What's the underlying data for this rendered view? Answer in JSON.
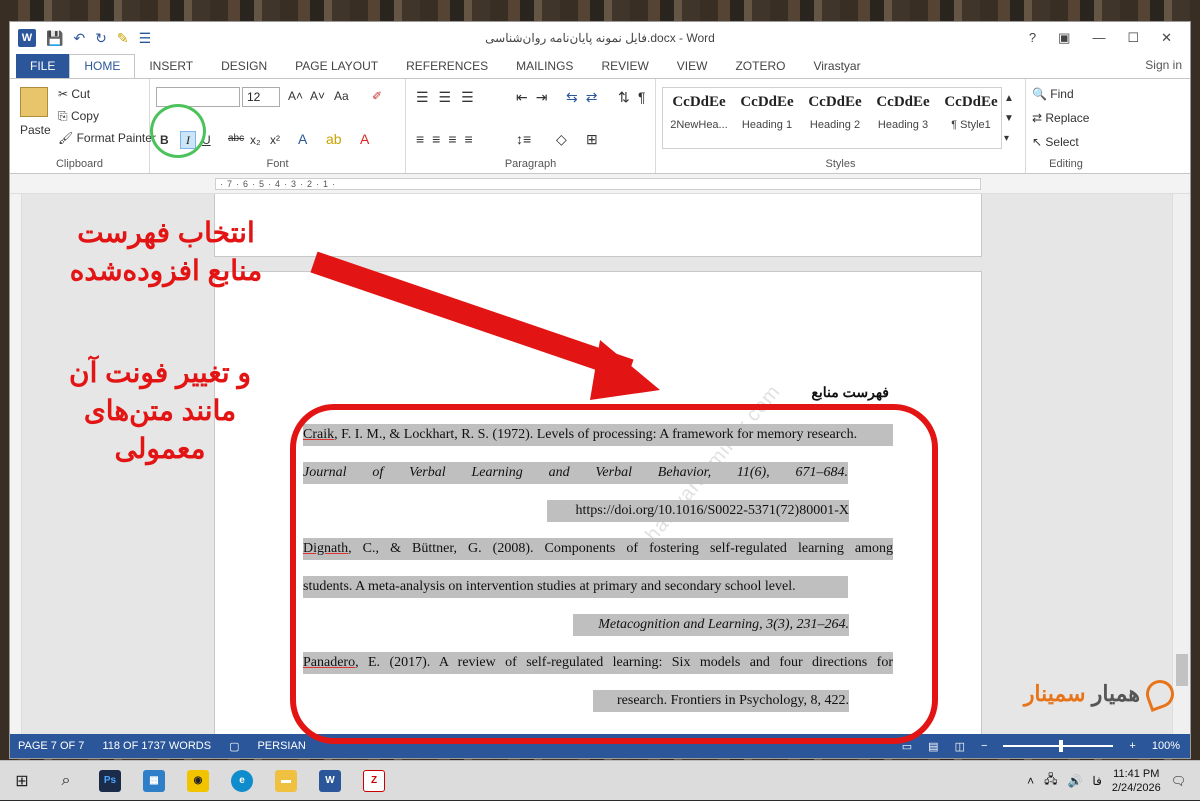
{
  "window": {
    "title": "فایل نمونه پایان‌نامه روان‌شناسی.docx - Word",
    "help": "?",
    "controls": [
      "—",
      "☐",
      "✕"
    ]
  },
  "qat": {
    "save_icon": "save-icon",
    "undo_icon": "undo-icon",
    "redo_icon": "redo-icon"
  },
  "tabs": {
    "file": "FILE",
    "home": "HOME",
    "insert": "INSERT",
    "design": "DESIGN",
    "page_layout": "PAGE LAYOUT",
    "references": "REFERENCES",
    "mailings": "MAILINGS",
    "review": "REVIEW",
    "view": "VIEW",
    "zotero": "ZOTERO",
    "virastyar": "Virastyar",
    "signin": "Sign in"
  },
  "clipboard": {
    "paste": "Paste",
    "cut": "Cut",
    "copy": "Copy",
    "format_painter": "Format Painter",
    "label": "Clipboard"
  },
  "font": {
    "name": "",
    "size": "12",
    "bold": "B",
    "italic": "I",
    "underline": "U",
    "strike": "abc",
    "sub": "x₂",
    "sup": "x²",
    "aa": "Aa",
    "label": "Font"
  },
  "paragraph": {
    "label": "Paragraph"
  },
  "styles": {
    "items": [
      {
        "preview": "CcDdEe",
        "name": "2NewHea..."
      },
      {
        "preview": "CcDdEe",
        "name": "Heading 1"
      },
      {
        "preview": "CcDdEe",
        "name": "Heading 2"
      },
      {
        "preview": "CcDdEe",
        "name": "Heading 3"
      },
      {
        "preview": "CcDdEe",
        "name": "¶ Style1"
      }
    ],
    "label": "Styles"
  },
  "editing": {
    "find": "Find",
    "replace": "Replace",
    "select": "Select",
    "label": "Editing"
  },
  "ruler": {
    "marks": "·7·6·5·4·3·2·1·"
  },
  "document": {
    "heading": "فهرست منابع",
    "refs": [
      {
        "line1_author": "Craik",
        "line1_rest": ", F. I. M., & Lockhart, R. S. (1972). Levels of processing: A framework for memory research.",
        "line2": "Journal of Verbal Learning and Verbal Behavior, 11(6), 671–684.",
        "line3": "https://doi.org/10.1016/S0022-5371(72)80001-X"
      },
      {
        "line1_author": "Dignath",
        "line1_rest": ", C., & Büttner, G. (2008). Components of fostering self-regulated learning among",
        "line2": "students. A meta-analysis on intervention studies at primary and secondary school level.",
        "line3": "Metacognition and Learning, 3(3), 231–264."
      },
      {
        "line1_author": "Panadero",
        "line1_rest": ", E. (2017). A review of self-regulated learning: Six models and four directions for",
        "line2": "research. Frontiers in Psychology, 8, 422."
      }
    ],
    "watermark": "hamyarseminar.com"
  },
  "annotation": {
    "line1": "انتخاب فهرست",
    "line2": "منابع افزوده‌شده",
    "line3": "و تغییر فونت آن",
    "line4": "مانند متن‌های",
    "line5": "معمولی"
  },
  "status": {
    "page": "PAGE 7 OF 7",
    "words": "118 OF 1737 WORDS",
    "language": "PERSIAN",
    "zoom": "100%"
  },
  "taskbar": {
    "time": "11:41 PM",
    "date": "2/24/2026",
    "lang": "فا"
  },
  "brand": {
    "part1": "همیار",
    "part2": "سمینار"
  }
}
